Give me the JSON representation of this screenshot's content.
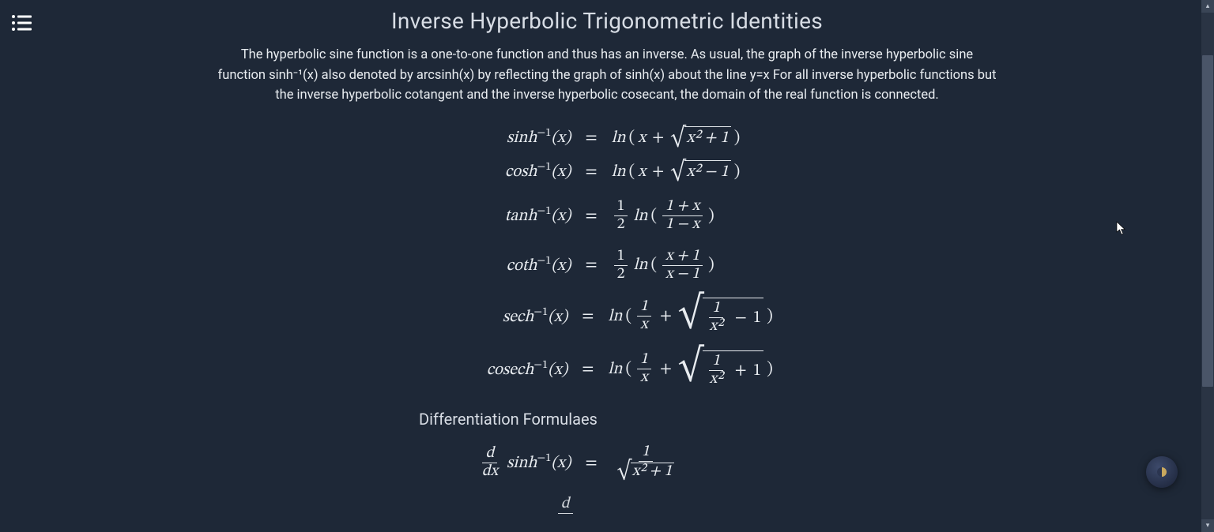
{
  "page": {
    "title": "Inverse Hyperbolic Trigonometric Identities",
    "intro": "The hyperbolic sine function is a one-to-one function and thus has an inverse. As usual, the graph of the inverse hyperbolic sine function sinh⁻¹(x) also denoted by arcsinh(x) by reflecting the graph of sinh(x) about the line y=x For all inverse hyperbolic functions but the inverse hyperbolic cotangent and the inverse hyperbolic cosecant, the domain of the real function is connected.",
    "subheading": "Differentiation Formulaes"
  },
  "identities": {
    "sinh": {
      "lhs_fn": "sinh",
      "rhs_plain": "ln(x + √(x² + 1))"
    },
    "cosh": {
      "lhs_fn": "cosh",
      "rhs_plain": "ln(x + √(x² − 1))"
    },
    "tanh": {
      "lhs_fn": "tanh",
      "rhs_plain": "½ ln((1 + x)/(1 − x))"
    },
    "coth": {
      "lhs_fn": "coth",
      "rhs_plain": "½ ln((x + 1)/(x − 1))"
    },
    "sech": {
      "lhs_fn": "sech",
      "rhs_plain": "ln(1/x + √(1/x² − 1))"
    },
    "cosech": {
      "lhs_fn": "cosech",
      "rhs_plain": "ln(1/x + √(1/x² + 1))"
    }
  },
  "derivatives": {
    "sinh": {
      "lhs": "d/dx sinh⁻¹(x)",
      "rhs_plain": "1 / √(x² + 1)"
    }
  },
  "labels": {
    "eq": "=",
    "arg": "(x)",
    "inv_exp": "−1",
    "ln": "ln",
    "d": "d",
    "dx": "dx"
  },
  "glyphs": {
    "x": "x",
    "one": "1",
    "two": "2",
    "plus": "+",
    "minus": "−",
    "x2p1": "x² + 1",
    "x2m1": "x² − 1",
    "1px": "1 + x",
    "1mx": "1 − x",
    "xp1": "x + 1",
    "xm1": "x − 1",
    "1ox2": "x²"
  },
  "icons": {
    "menu": "menu",
    "theme": "theme-toggle"
  }
}
